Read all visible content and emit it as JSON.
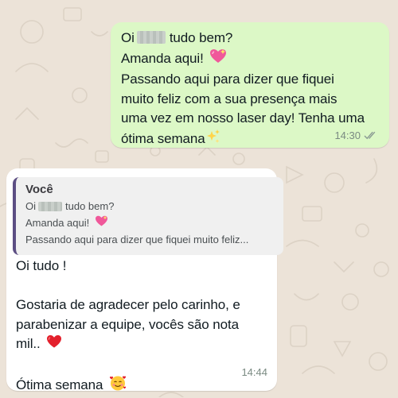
{
  "outgoing": {
    "greeting_prefix": "Oi",
    "greeting_suffix": "tudo bem?",
    "line2": "Amanda aqui!",
    "line3": "Passando aqui para dizer que fiquei",
    "line4": "muito feliz com a sua presença mais",
    "line5": "uma vez em nosso laser day! Tenha uma",
    "line6": "ótima semana",
    "time": "14:30",
    "emojis": [
      "sparkling-heart-icon",
      "sparkles-icon"
    ],
    "status_icon": "double-check-icon"
  },
  "incoming": {
    "quote": {
      "author": "Você",
      "line1_prefix": "Oi",
      "line1_suffix": "tudo bem?",
      "line2": "Amanda aqui!",
      "line3": "Passando aqui para dizer que fiquei muito feliz..."
    },
    "lines": [
      "Oi tudo !",
      "",
      "Gostaria de agradecer pelo carinho, e",
      "parabenizar a equipe, vocês são nota",
      "mil..",
      "",
      "Ótima semana"
    ],
    "time": "14:44",
    "emojis": [
      "red-heart-icon",
      "smiling-face-with-hearts-icon"
    ]
  },
  "colors": {
    "outgoing_bubble": "#dcf8c6",
    "incoming_bubble": "#ffffff",
    "chat_background": "#ece3d8",
    "quote_bar": "#5c4e83"
  }
}
